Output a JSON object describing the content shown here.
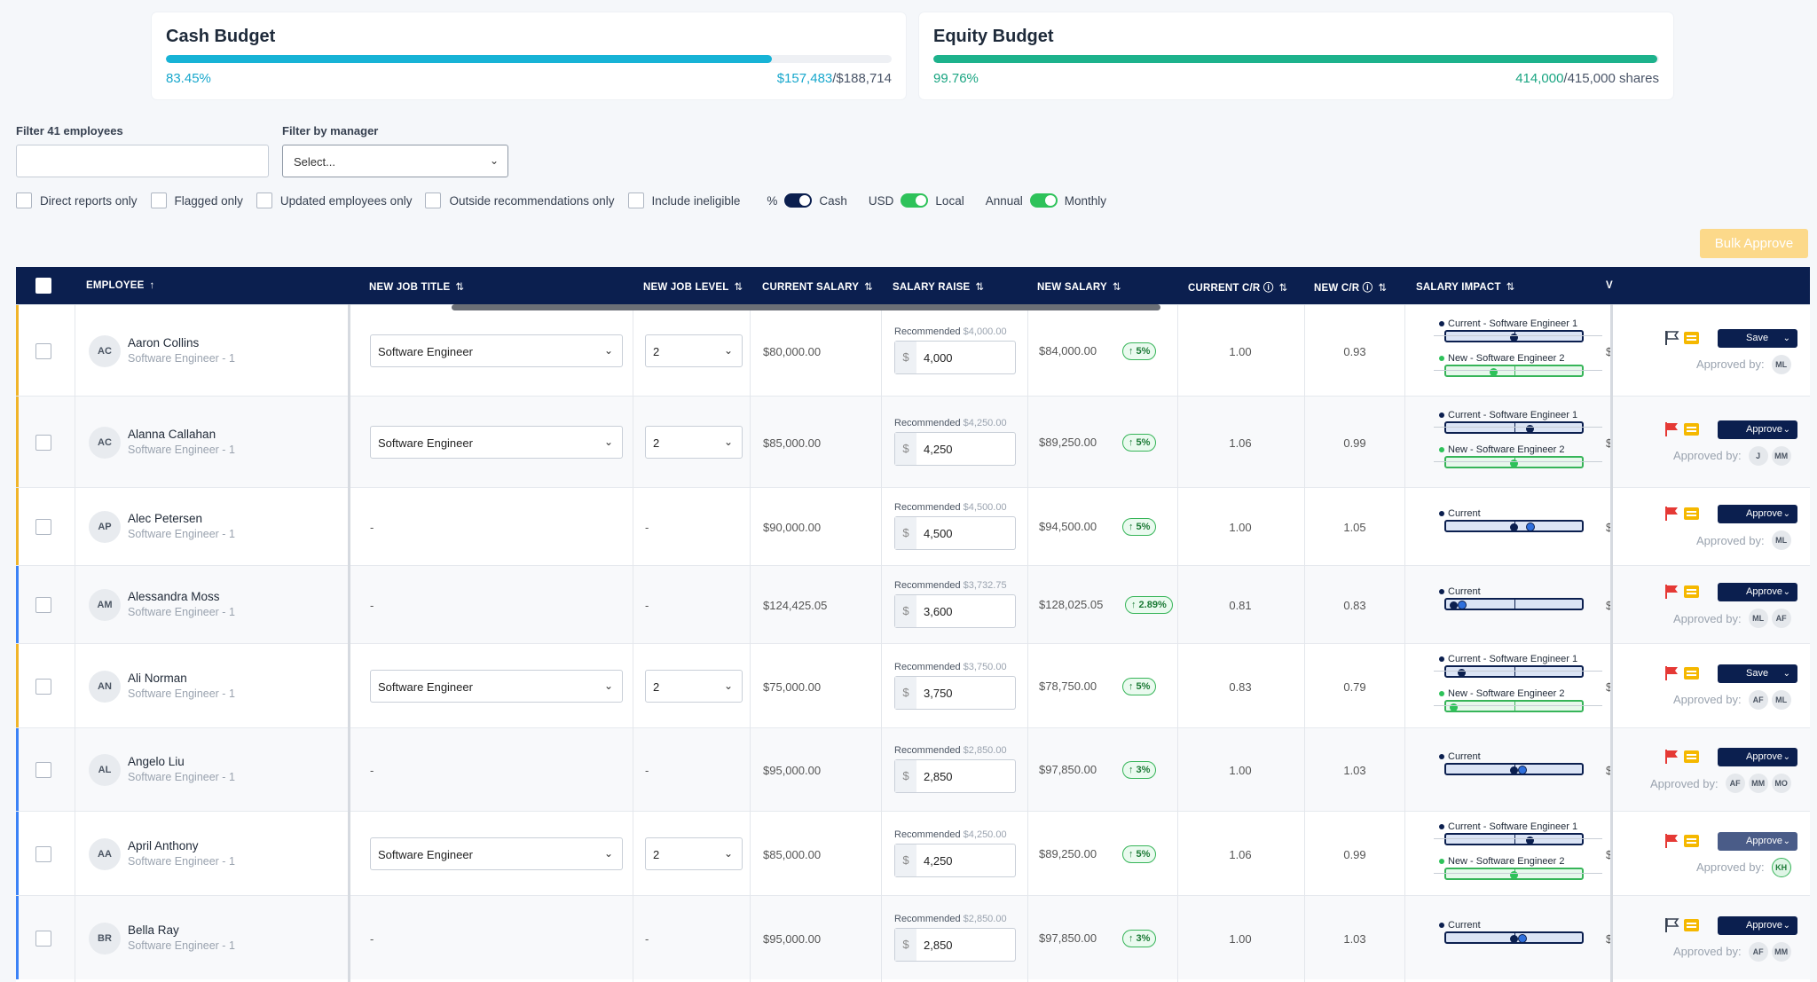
{
  "cash_budget": {
    "title": "Cash Budget",
    "percent": "83.45%",
    "used": "$157,483",
    "total": "/$188,714",
    "fill": 0.8345,
    "color": "#17b3d6"
  },
  "equity_budget": {
    "title": "Equity Budget",
    "percent": "99.76%",
    "used": "414,000",
    "total": "/415,000 shares",
    "fill": 0.9976,
    "color": "#1db28c"
  },
  "filters": {
    "employee_label": "Filter 41 employees",
    "employee_value": "",
    "manager_label": "Filter by manager",
    "manager_value": "Select..."
  },
  "checkboxes": [
    "Direct reports only",
    "Flagged only",
    "Updated employees only",
    "Outside recommendations only",
    "Include ineligible"
  ],
  "toggles": [
    {
      "left": "%",
      "right": "Cash"
    },
    {
      "left": "USD",
      "right": "Local"
    },
    {
      "left": "Annual",
      "right": "Monthly"
    }
  ],
  "bulk_approve": "Bulk Approve",
  "columns": {
    "employee": "EMPLOYEE",
    "job_title": "NEW JOB TITLE",
    "job_level": "NEW JOB LEVEL",
    "current_salary": "CURRENT SALARY",
    "salary_raise": "SALARY RAISE",
    "new_salary": "NEW SALARY",
    "current_cr": "CURRENT C/R",
    "new_cr": "NEW C/R",
    "salary_impact": "SALARY IMPACT",
    "v_cut": "V"
  },
  "approved_by_label": "Approved by:",
  "recommended_label": "Recommended",
  "rows": [
    {
      "initials": "AC",
      "name": "Aaron Collins",
      "sub": "Software Engineer - 1",
      "title": "Software Engineer",
      "level": "2",
      "current": "$80,000.00",
      "rec": "$4,000.00",
      "raise": "4,000",
      "new": "$84,000.00",
      "pct": "↑ 5%",
      "ccr": "1.00",
      "ncr": "0.93",
      "imp1": "Current - Software Engineer 1",
      "imp2": "New - Software Engineer 2",
      "action": "Save",
      "approvers": [
        "ML"
      ],
      "v": "$"
    },
    {
      "initials": "AC",
      "name": "Alanna Callahan",
      "sub": "Software Engineer - 1",
      "title": "Software Engineer",
      "level": "2",
      "current": "$85,000.00",
      "rec": "$4,250.00",
      "raise": "4,250",
      "new": "$89,250.00",
      "pct": "↑ 5%",
      "ccr": "1.06",
      "ncr": "0.99",
      "imp1": "Current - Software Engineer 1",
      "imp2": "New - Software Engineer 2",
      "action": "Approve",
      "approvers": [
        "J",
        "MM"
      ],
      "v": "$"
    },
    {
      "initials": "AP",
      "name": "Alec Petersen",
      "sub": "Software Engineer - 1",
      "title": "-",
      "level": "-",
      "current": "$90,000.00",
      "rec": "$4,500.00",
      "raise": "4,500",
      "new": "$94,500.00",
      "pct": "↑ 5%",
      "ccr": "1.00",
      "ncr": "1.05",
      "imp1": "Current",
      "imp2": "",
      "action": "Approve",
      "approvers": [
        "ML"
      ],
      "v": "$"
    },
    {
      "initials": "AM",
      "name": "Alessandra Moss",
      "sub": "Software Engineer - 1",
      "title": "-",
      "level": "-",
      "current": "$124,425.05",
      "rec": "$3,732.75",
      "raise": "3,600",
      "new": "$128,025.05",
      "pct": "↑ 2.89%",
      "ccr": "0.81",
      "ncr": "0.83",
      "imp1": "Current",
      "imp2": "",
      "action": "Approve",
      "approvers": [
        "ML",
        "AF"
      ],
      "v": "$"
    },
    {
      "initials": "AN",
      "name": "Ali Norman",
      "sub": "Software Engineer - 1",
      "title": "Software Engineer",
      "level": "2",
      "current": "$75,000.00",
      "rec": "$3,750.00",
      "raise": "3,750",
      "new": "$78,750.00",
      "pct": "↑ 5%",
      "ccr": "0.83",
      "ncr": "0.79",
      "imp1": "Current - Software Engineer 1",
      "imp2": "New - Software Engineer 2",
      "action": "Save",
      "approvers": [
        "AF",
        "ML"
      ],
      "v": "$"
    },
    {
      "initials": "AL",
      "name": "Angelo Liu",
      "sub": "Software Engineer - 1",
      "title": "-",
      "level": "-",
      "current": "$95,000.00",
      "rec": "$2,850.00",
      "raise": "2,850",
      "new": "$97,850.00",
      "pct": "↑ 3%",
      "ccr": "1.00",
      "ncr": "1.03",
      "imp1": "Current",
      "imp2": "",
      "action": "Approve",
      "approvers": [
        "AF",
        "MM",
        "MO"
      ],
      "v": "$"
    },
    {
      "initials": "AA",
      "name": "April Anthony",
      "sub": "Software Engineer - 1",
      "title": "Software Engineer",
      "level": "2",
      "current": "$85,000.00",
      "rec": "$4,250.00",
      "raise": "4,250",
      "new": "$89,250.00",
      "pct": "↑ 5%",
      "ccr": "1.06",
      "ncr": "0.99",
      "imp1": "Current - Software Engineer 1",
      "imp2": "New - Software Engineer 2",
      "action": "Approve",
      "approvers": [
        "KH"
      ],
      "v": "$"
    },
    {
      "initials": "BR",
      "name": "Bella Ray",
      "sub": "Software Engineer - 1",
      "title": "-",
      "level": "-",
      "current": "$95,000.00",
      "rec": "$2,850.00",
      "raise": "2,850",
      "new": "$97,850.00",
      "pct": "↑ 3%",
      "ccr": "1.00",
      "ncr": "1.03",
      "imp1": "Current",
      "imp2": "",
      "action": "Approve",
      "approvers": [
        "AF",
        "MM"
      ],
      "v": "$"
    }
  ]
}
